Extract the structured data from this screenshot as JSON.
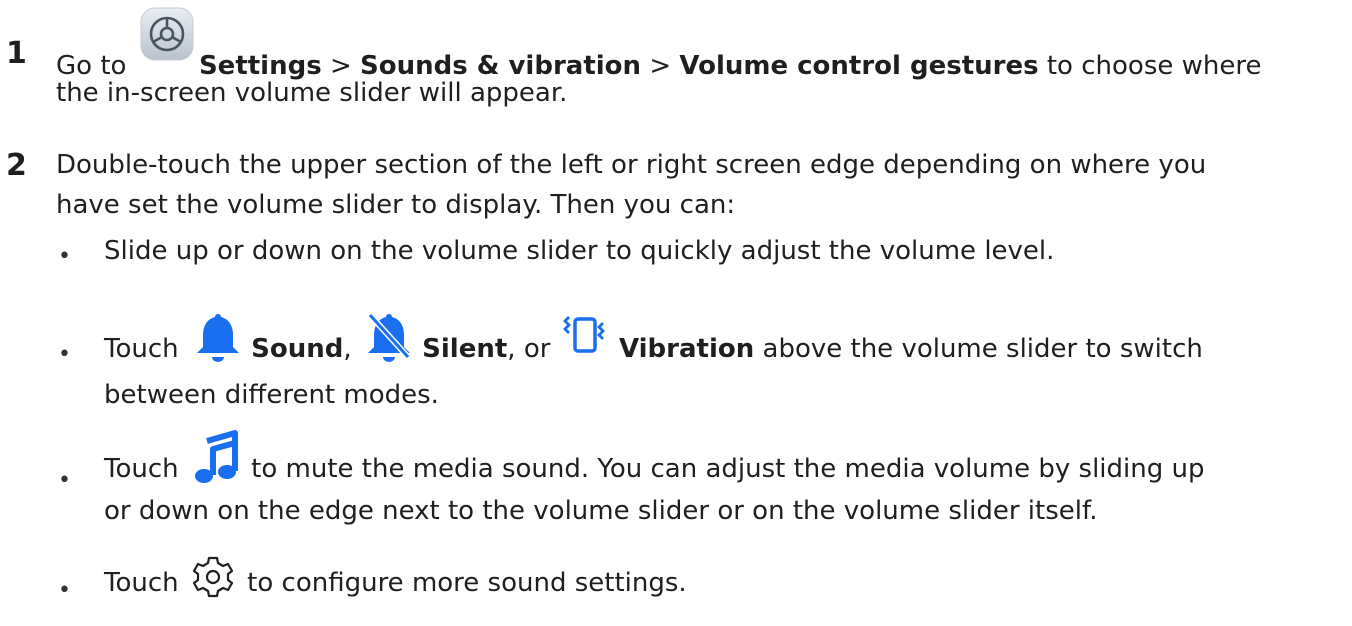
{
  "steps": [
    {
      "number": "1",
      "go_to": "Go to",
      "settings": "Settings",
      "sep1": ">",
      "sounds_vibration": "Sounds & vibration",
      "sep2": ">",
      "volume_gestures": "Volume control gestures",
      "tail1": "to choose where",
      "line2": "the in-screen volume slider will appear."
    },
    {
      "number": "2",
      "line1": "Double-touch the upper section of the left or right screen edge depending on where you",
      "line2": "have set the volume slider to display. Then you can:"
    }
  ],
  "bullets": {
    "b1": "Slide up or down on the volume slider to quickly adjust the volume level.",
    "b2_touch": "Touch",
    "b2_sound": "Sound",
    "b2_comma1": ",",
    "b2_silent": "Silent",
    "b2_or": ", or",
    "b2_vibration": "Vibration",
    "b2_tail": "above the volume slider to switch",
    "b2_line2": "between different modes.",
    "b3_touch": "Touch",
    "b3_tail": "to mute the media sound. You can adjust the media volume by sliding up",
    "b3_line2": "or down on the edge next to the volume slider or on the volume slider itself.",
    "b4_touch": "Touch",
    "b4_tail": "to configure more sound settings.",
    "dot": "•"
  },
  "icons": {
    "settings_app": "settings-app-icon",
    "sound": "bell-icon",
    "silent": "bell-off-icon",
    "vibration": "vibration-icon",
    "music": "music-note-icon",
    "gear": "gear-icon"
  },
  "colors": {
    "accent_blue": "#1a6ff0",
    "text": "#1f1f1f"
  }
}
